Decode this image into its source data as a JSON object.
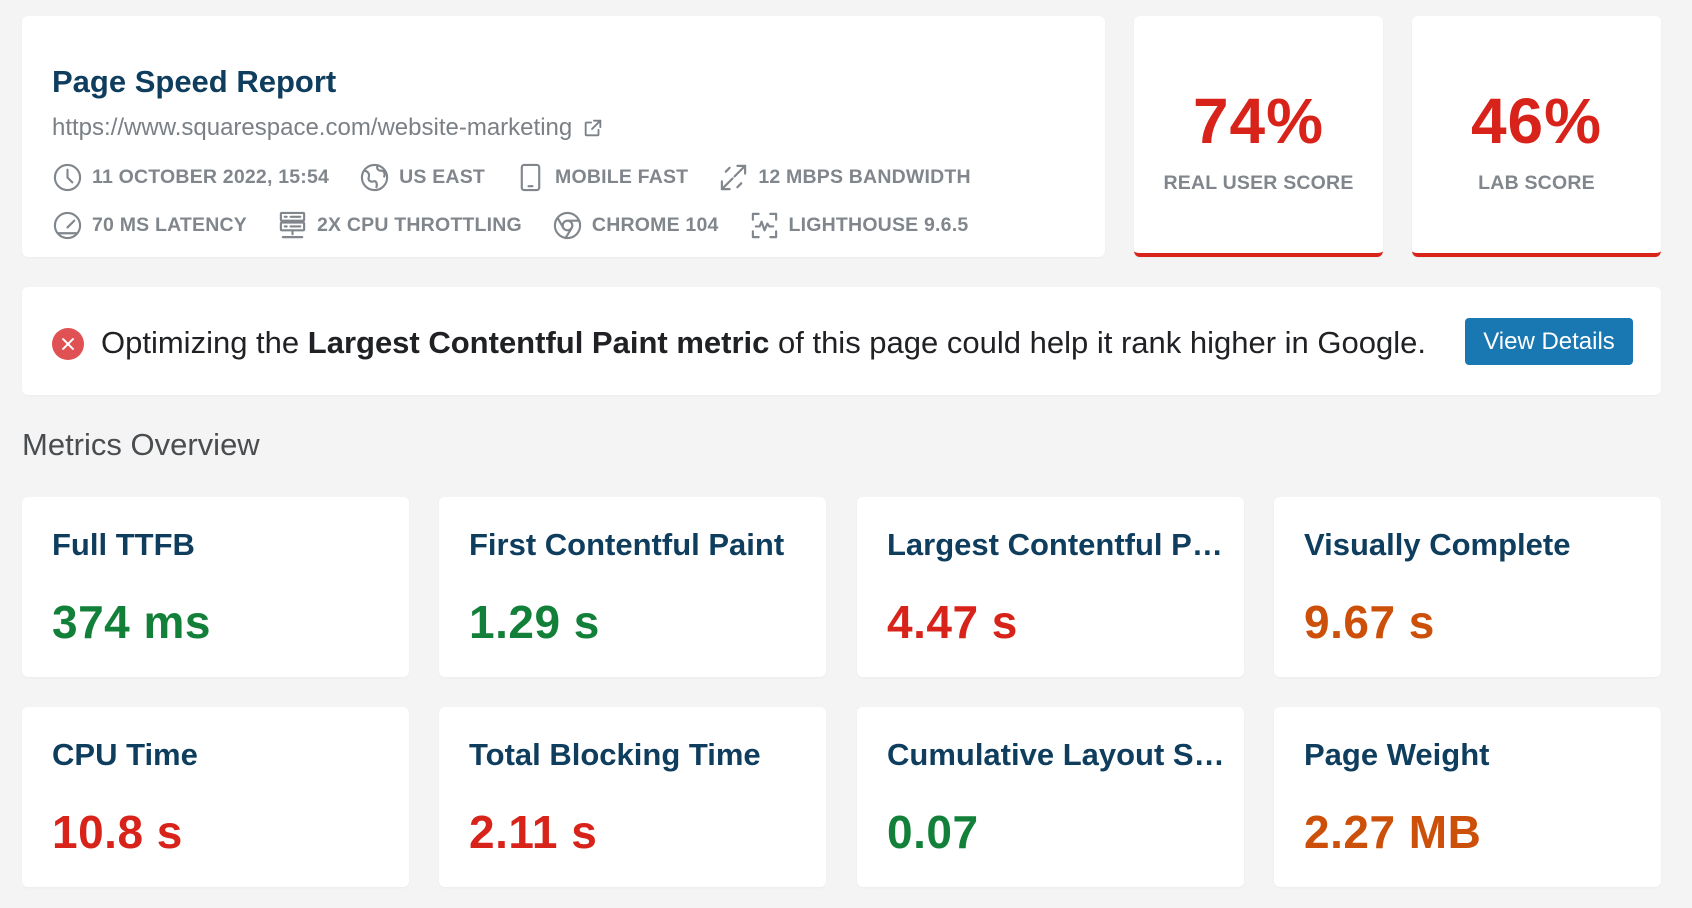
{
  "header": {
    "title": "Page Speed Report",
    "url": "https://www.squarespace.com/website-marketing",
    "meta_row_1": [
      {
        "icon": "clock-icon",
        "label": "11 OCTOBER 2022, 15:54"
      },
      {
        "icon": "globe-icon",
        "label": "US EAST"
      },
      {
        "icon": "mobile-device-icon",
        "label": "MOBILE FAST"
      },
      {
        "icon": "bandwidth-arrows-icon",
        "label": "12 MBPS BANDWIDTH"
      }
    ],
    "meta_row_2": [
      {
        "icon": "latency-gauge-icon",
        "label": "70 MS LATENCY"
      },
      {
        "icon": "cpu-server-icon",
        "label": "2X CPU THROTTLING"
      },
      {
        "icon": "chrome-icon",
        "label": "CHROME 104"
      },
      {
        "icon": "lighthouse-icon",
        "label": "LIGHTHOUSE 9.6.5"
      }
    ]
  },
  "scores": {
    "real_user": {
      "value": "74%",
      "label": "REAL USER SCORE"
    },
    "lab": {
      "value": "46%",
      "label": "LAB SCORE"
    }
  },
  "alert": {
    "icon": "error-x-icon",
    "text_before": "Optimizing the ",
    "text_bold": "Largest Contentful Paint metric",
    "text_after": " of this page could help it rank higher in Google.",
    "button": "View Details"
  },
  "metrics_section": {
    "title": "Metrics Overview",
    "metrics": [
      {
        "name": "Full TTFB",
        "value": "374 ms",
        "status": "good"
      },
      {
        "name": "First Contentful Paint",
        "value": "1.29 s",
        "status": "good"
      },
      {
        "name": "Largest Contentful Paint",
        "value": "4.47 s",
        "status": "poor"
      },
      {
        "name": "Visually Complete",
        "value": "9.67 s",
        "status": "needs-improvement"
      },
      {
        "name": "CPU Time",
        "value": "10.8 s",
        "status": "poor"
      },
      {
        "name": "Total Blocking Time",
        "value": "2.11 s",
        "status": "poor"
      },
      {
        "name": "Cumulative Layout Shift",
        "value": "0.07",
        "status": "good"
      },
      {
        "name": "Page Weight",
        "value": "2.27 MB",
        "status": "needs-improvement"
      }
    ]
  },
  "colors": {
    "title_navy": "#0e3d5e",
    "good": "#13803a",
    "poor": "#d8231a",
    "needs_improvement": "#cc4f0a",
    "button_blue": "#1977b2",
    "background": "#f4f4f4"
  }
}
